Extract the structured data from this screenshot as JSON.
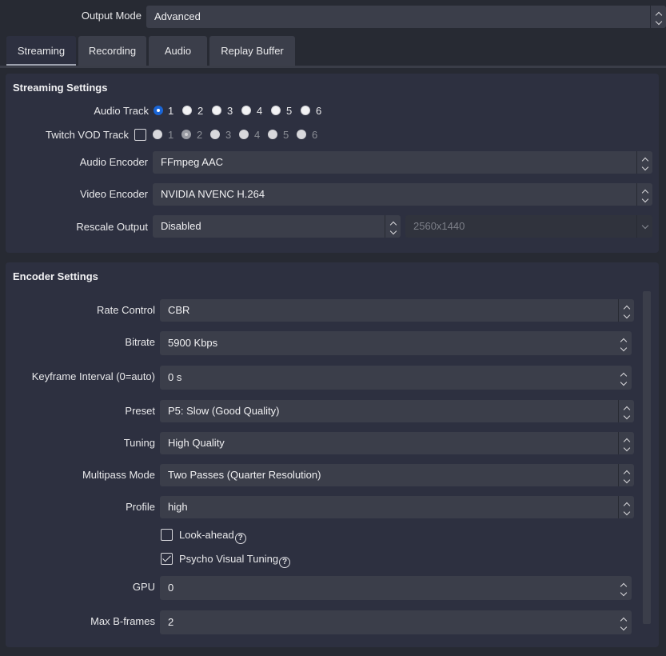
{
  "output_mode": {
    "label": "Output Mode",
    "value": "Advanced"
  },
  "tabs": [
    {
      "label": "Streaming",
      "active": true
    },
    {
      "label": "Recording",
      "active": false
    },
    {
      "label": "Audio",
      "active": false
    },
    {
      "label": "Replay Buffer",
      "active": false
    }
  ],
  "streaming": {
    "title": "Streaming Settings",
    "audio_track": {
      "label": "Audio Track",
      "options": [
        "1",
        "2",
        "3",
        "4",
        "5",
        "6"
      ],
      "selected": "1"
    },
    "twitch_vod": {
      "label": "Twitch VOD Track",
      "options": [
        "1",
        "2",
        "3",
        "4",
        "5",
        "6"
      ],
      "selected": "2",
      "enabled": false
    },
    "audio_encoder": {
      "label": "Audio Encoder",
      "value": "FFmpeg AAC"
    },
    "video_encoder": {
      "label": "Video Encoder",
      "value": "NVIDIA NVENC H.264"
    },
    "rescale": {
      "label": "Rescale Output",
      "value": "Disabled",
      "resolution": "2560x1440"
    }
  },
  "encoder": {
    "title": "Encoder Settings",
    "rate_control": {
      "label": "Rate Control",
      "value": "CBR"
    },
    "bitrate": {
      "label": "Bitrate",
      "value": "5900 Kbps"
    },
    "keyframe": {
      "label": "Keyframe Interval (0=auto)",
      "value": "0 s"
    },
    "preset": {
      "label": "Preset",
      "value": "P5: Slow (Good Quality)"
    },
    "tuning": {
      "label": "Tuning",
      "value": "High Quality"
    },
    "multipass": {
      "label": "Multipass Mode",
      "value": "Two Passes (Quarter Resolution)"
    },
    "profile": {
      "label": "Profile",
      "value": "high"
    },
    "lookahead": {
      "label": "Look-ahead",
      "checked": false
    },
    "psycho": {
      "label": "Psycho Visual Tuning",
      "checked": true
    },
    "gpu": {
      "label": "GPU",
      "value": "0"
    },
    "bframes": {
      "label": "Max B-frames",
      "value": "2"
    }
  },
  "icons": {
    "help": "?"
  },
  "colors": {
    "background": "#272a33",
    "panel": "#2d3040",
    "control": "#3b3e4a",
    "accent": "#1a65d6"
  }
}
